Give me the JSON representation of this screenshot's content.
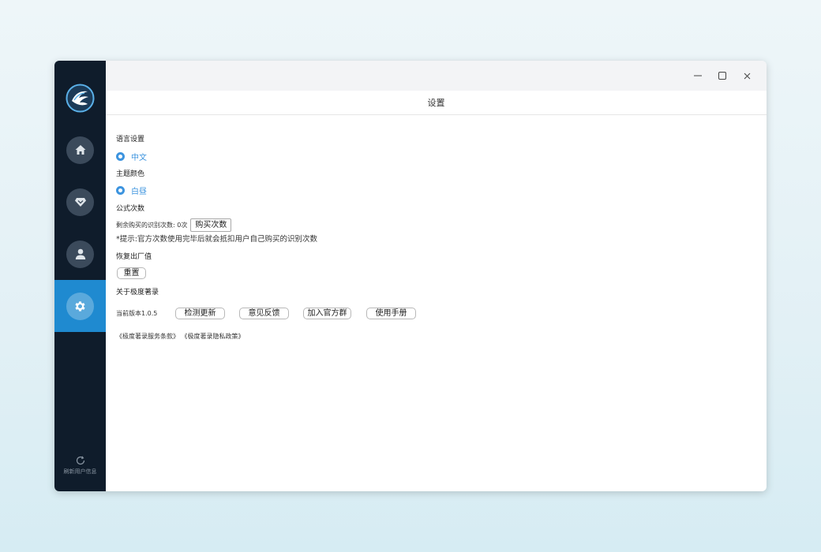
{
  "app": {
    "header_title": "设置"
  },
  "sidebar": {
    "items": [
      {
        "name": "home",
        "icon": "home-icon"
      },
      {
        "name": "gem",
        "icon": "gem-icon"
      },
      {
        "name": "user",
        "icon": "user-icon"
      },
      {
        "name": "settings",
        "icon": "gear-icon",
        "active": true
      }
    ],
    "refresh_label": "刷新用户信息"
  },
  "colors": {
    "sidebar_bg": "#0f1c2b",
    "active": "#1f8ad0",
    "accent": "#3d94df"
  },
  "settings": {
    "language": {
      "title": "语言设置",
      "option": "中文"
    },
    "theme": {
      "title": "主题颜色",
      "option": "白昼"
    },
    "formula": {
      "title": "公式次数",
      "remaining_label": "剩余购买的识别次数: 0次",
      "buy_button": "购买次数",
      "tip": "*提示:官方次数使用完毕后就会抵扣用户自己购买的识别次数"
    },
    "reset": {
      "title": "恢复出厂值",
      "button": "重置"
    },
    "about": {
      "title": "关于极度著录",
      "version": "当前版本1.0.5",
      "buttons": [
        "检测更新",
        "意见反馈",
        "加入官方群",
        "使用手册"
      ],
      "terms_link": "《极度著录服务条款》",
      "privacy_link": "《极度著录隐私政策》"
    }
  }
}
